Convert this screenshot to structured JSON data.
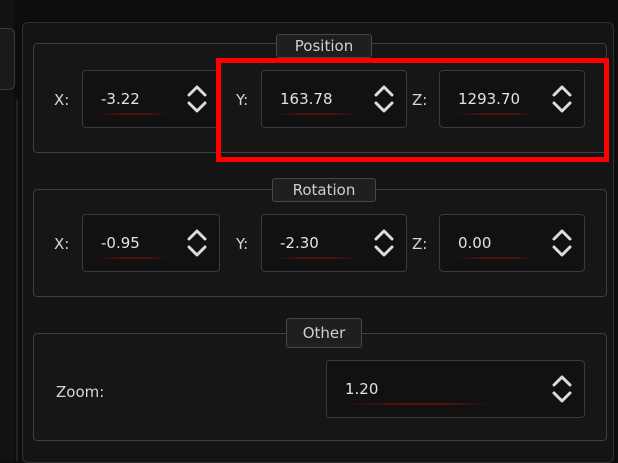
{
  "position": {
    "title": "Position",
    "x_label": "X:",
    "x_value": "-3.22",
    "y_label": "Y:",
    "y_value": "163.78",
    "z_label": "Z:",
    "z_value": "1293.70"
  },
  "rotation": {
    "title": "Rotation",
    "x_label": "X:",
    "x_value": "-0.95",
    "y_label": "Y:",
    "y_value": "-2.30",
    "z_label": "Z:",
    "z_value": "0.00"
  },
  "other": {
    "title": "Other",
    "zoom_label": "Zoom:",
    "zoom_value": "1.20"
  },
  "colors": {
    "highlight": "#ff0000",
    "background": "#141414"
  },
  "icons": {
    "spin_arrows": "chevron-up-down-icon"
  }
}
